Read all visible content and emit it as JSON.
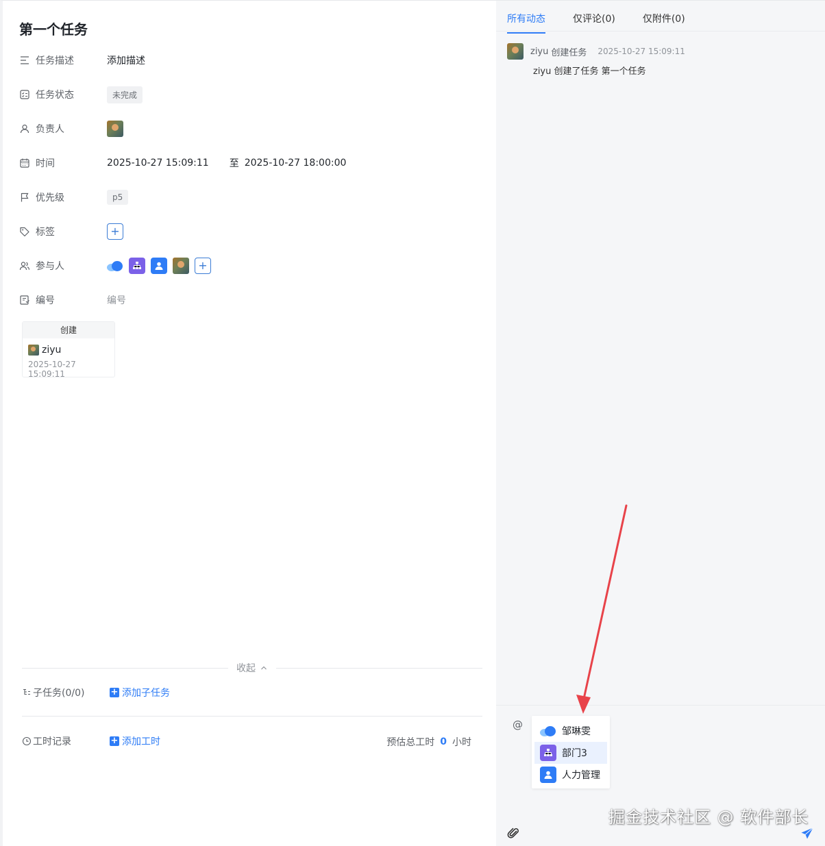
{
  "task": {
    "title": "第一个任务",
    "fields": {
      "description": {
        "label": "任务描述",
        "value": "添加描述"
      },
      "status": {
        "label": "任务状态",
        "value": "未完成"
      },
      "assignee": {
        "label": "负责人"
      },
      "time": {
        "label": "时间",
        "start": "2025-10-27 15:09:11",
        "separator": "至",
        "end": "2025-10-27 18:00:00"
      },
      "priority": {
        "label": "优先级",
        "value": "p5"
      },
      "tags": {
        "label": "标签",
        "add": "+"
      },
      "participants": {
        "label": "参与人",
        "add": "+"
      },
      "number": {
        "label": "编号",
        "placeholder": "编号"
      }
    },
    "created": {
      "header": "创建",
      "user": "ziyu",
      "time": "2025-10-27 15:09:11"
    },
    "collapse_label": "收起",
    "subtasks": {
      "label": "子任务(0/0)",
      "add_label": "添加子任务"
    },
    "worklog": {
      "label": "工时记录",
      "add_label": "添加工时",
      "estimate_label": "预估总工时",
      "estimate_value": "0",
      "estimate_unit": "小时"
    }
  },
  "activity_panel": {
    "tabs": [
      {
        "label": "所有动态",
        "active": true
      },
      {
        "label": "仅评论(0)",
        "active": false
      },
      {
        "label": "仅附件(0)",
        "active": false
      }
    ],
    "entries": [
      {
        "user": "ziyu",
        "action": "创建任务",
        "time": "2025-10-27 15:09:11",
        "body": "ziyu 创建了任务 第一个任务"
      }
    ],
    "mention_trigger": "@",
    "mention_options": [
      "邹琳雯",
      "部门3",
      "人力管理"
    ],
    "watermark": "掘金技术社区 @ 软件部长"
  },
  "colors": {
    "accent": "#2e7cf6",
    "org_icon": "#7b61e8",
    "arrow": "#e8434a"
  }
}
